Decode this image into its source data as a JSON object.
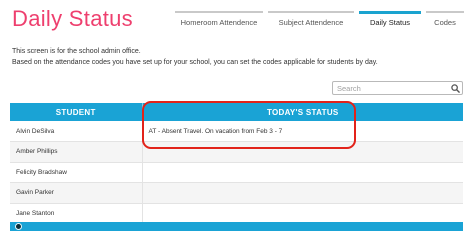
{
  "header": {
    "title": "Daily Status",
    "tabs": [
      {
        "label": "Homeroom Attendence",
        "active": false
      },
      {
        "label": "Subject Attendence",
        "active": false
      },
      {
        "label": "Daily Status",
        "active": true
      },
      {
        "label": "Codes",
        "active": false
      }
    ]
  },
  "intro": {
    "line1": "This screen is for the school admin office.",
    "line2": "Based on the attendance codes you have set up for your school, you can set the codes applicable for students by day."
  },
  "search": {
    "placeholder": "Search",
    "value": ""
  },
  "table": {
    "columns": [
      "STUDENT",
      "TODAY'S STATUS"
    ],
    "rows": [
      {
        "student": "Alvin DeSilva",
        "status": "AT - Absent Travel. On vacation from Feb 3 - 7"
      },
      {
        "student": "Amber Phillips",
        "status": ""
      },
      {
        "student": "Felicity Bradshaw",
        "status": ""
      },
      {
        "student": "Gavin Parker",
        "status": ""
      },
      {
        "student": "Jane Stanton",
        "status": ""
      }
    ]
  },
  "colors": {
    "accent": "#ee3f6e",
    "header_blue": "#1aa3d5",
    "highlight_red": "#e2231a"
  }
}
